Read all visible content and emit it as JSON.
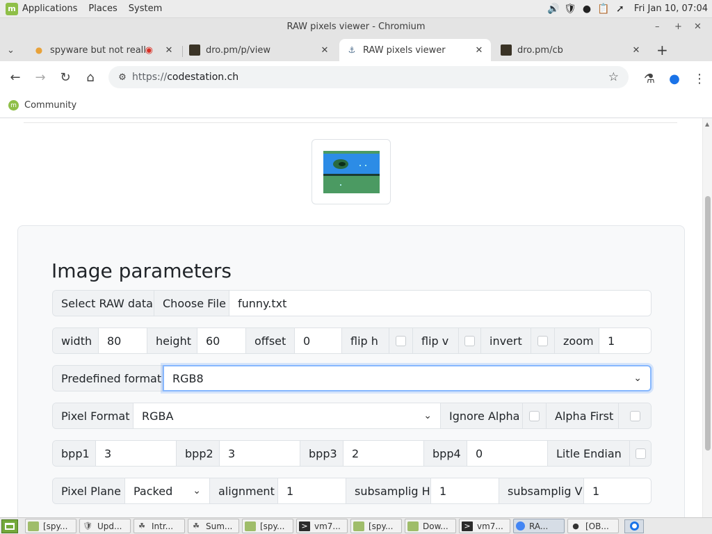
{
  "os_panel": {
    "menus": [
      "Applications",
      "Places",
      "System"
    ],
    "clock": "Fri Jan 10, 07:04"
  },
  "window": {
    "title": "RAW pixels viewer - Chromium"
  },
  "tabs": [
    {
      "title": "spyware but not really",
      "active": false,
      "recording": true
    },
    {
      "title": "dro.pm/p/view",
      "active": false
    },
    {
      "title": "RAW pixels viewer",
      "active": true
    },
    {
      "title": "dro.pm/cb",
      "active": false
    }
  ],
  "toolbar": {
    "url_scheme": "https://",
    "url_host": "codestation.ch"
  },
  "bookmarks": [
    {
      "label": "Community"
    }
  ],
  "form": {
    "heading": "Image parameters",
    "raw_data": {
      "label": "Select RAW data",
      "button": "Choose File",
      "file_name": "funny.txt"
    },
    "geometry": {
      "width_label": "width",
      "width_value": "80",
      "height_label": "height",
      "height_value": "60",
      "offset_label": "offset",
      "offset_value": "0",
      "flip_h_label": "flip h",
      "flip_h": false,
      "flip_v_label": "flip v",
      "flip_v": false,
      "invert_label": "invert",
      "invert": false,
      "zoom_label": "zoom",
      "zoom_value": "1"
    },
    "predefined": {
      "label": "Predefined format",
      "value": "RGB8"
    },
    "pixel_format": {
      "label": "Pixel Format",
      "value": "RGBA",
      "ignore_alpha_label": "Ignore Alpha",
      "ignore_alpha": false,
      "alpha_first_label": "Alpha First",
      "alpha_first": false
    },
    "bpp": {
      "bpp1_label": "bpp1",
      "bpp1_value": "3",
      "bpp2_label": "bpp2",
      "bpp2_value": "3",
      "bpp3_label": "bpp3",
      "bpp3_value": "2",
      "bpp4_label": "bpp4",
      "bpp4_value": "0",
      "little_endian_label": "Litle Endian",
      "little_endian": false
    },
    "plane": {
      "label": "Pixel Plane",
      "value": "Packed",
      "alignment_label": "alignment",
      "alignment_value": "1",
      "subsampling_h_label": "subsamplig H",
      "subsampling_h_value": "1",
      "subsampling_v_label": "subsamplig V",
      "subsampling_v_value": "1"
    }
  },
  "taskbar": {
    "items": [
      "[spy...",
      "Upd...",
      "Intr...",
      "Sum...",
      "[spy...",
      "vm7...",
      "[spy...",
      "Dow...",
      "vm7...",
      "RA...",
      "[OB..."
    ]
  },
  "colors": {
    "accent": "#1a73e8",
    "mint_green": "#8fbf48",
    "focus_ring": "#86b7fe"
  }
}
